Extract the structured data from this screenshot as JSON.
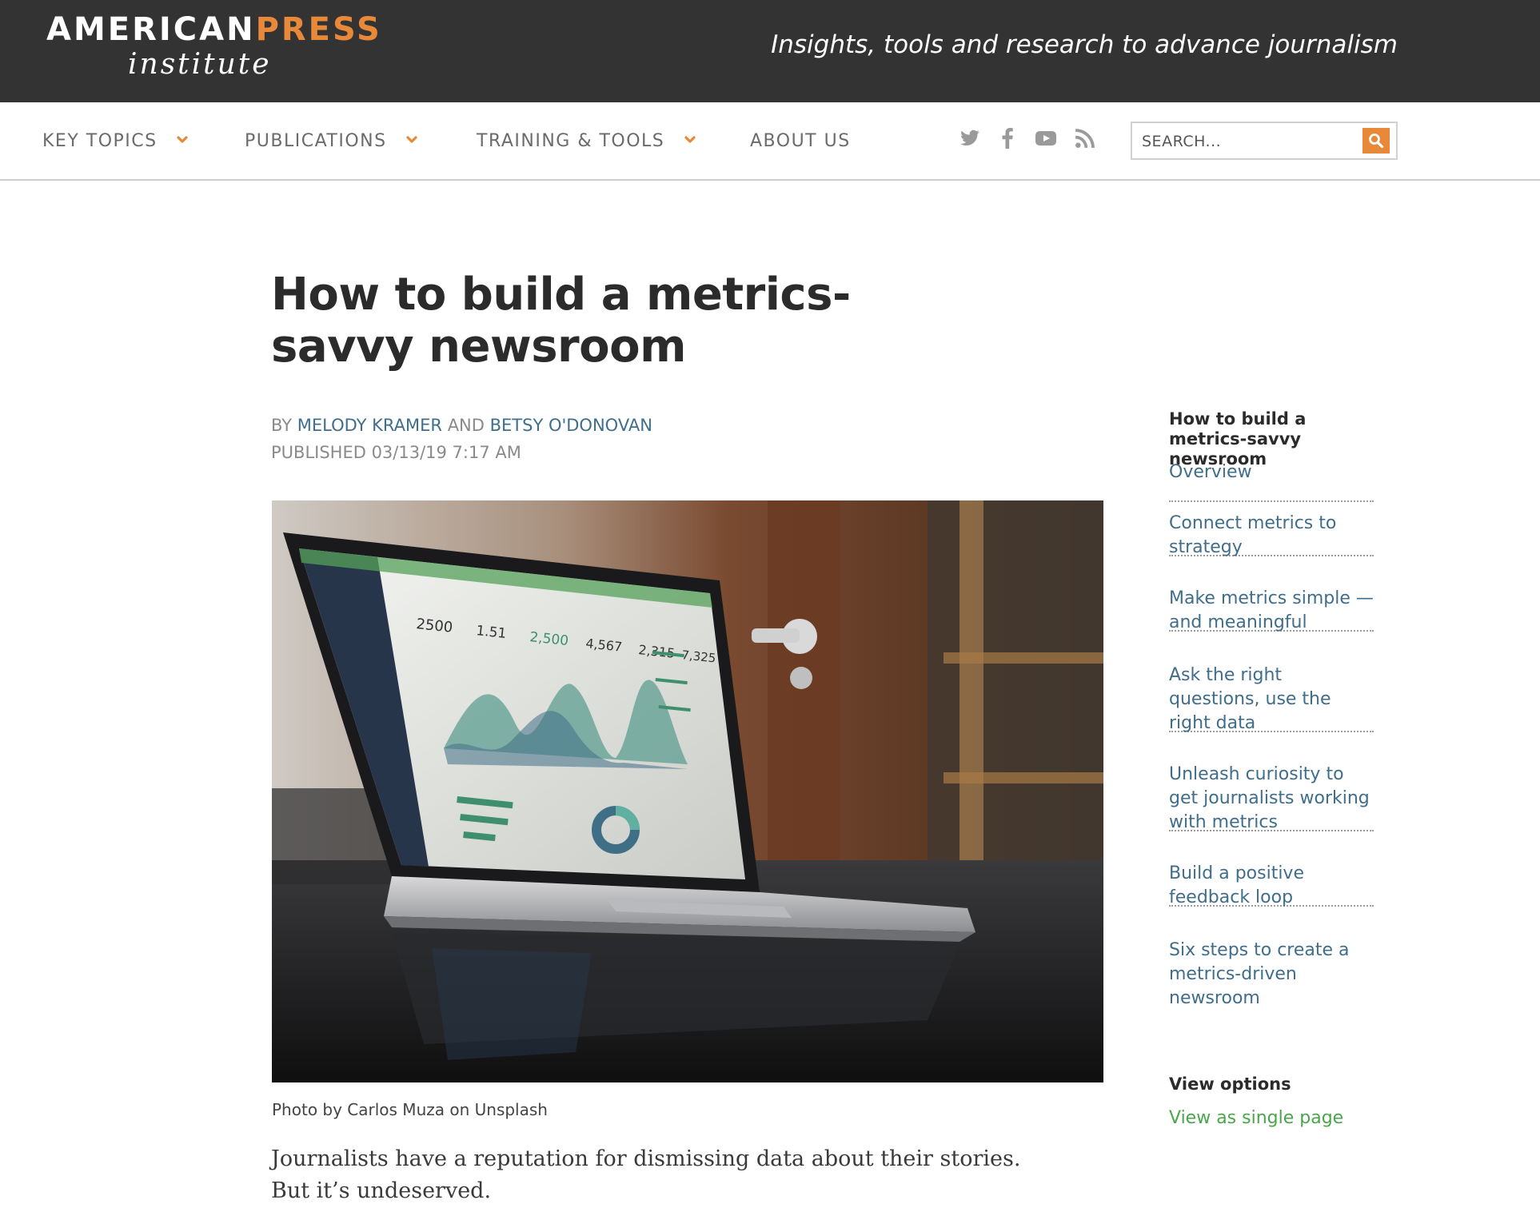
{
  "header": {
    "logo_line1_a": "AMERICAN",
    "logo_line1_b": "PRESS",
    "logo_line2": "institute",
    "tagline": "Insights, tools and research to advance journalism"
  },
  "nav": {
    "items": [
      {
        "label": "KEY TOPICS",
        "has_dropdown": true
      },
      {
        "label": "PUBLICATIONS",
        "has_dropdown": true
      },
      {
        "label": "TRAINING & TOOLS",
        "has_dropdown": true
      },
      {
        "label": "ABOUT US",
        "has_dropdown": false
      }
    ],
    "social_icons": [
      "twitter-icon",
      "facebook-icon",
      "youtube-icon",
      "rss-icon"
    ],
    "search": {
      "placeholder": "SEARCH...",
      "value": ""
    }
  },
  "article": {
    "title": "How to build a metrics-savvy newsroom",
    "by_prefix": "BY ",
    "author1": "MELODY KRAMER",
    "and": " AND ",
    "author2": "BETSY O'DONOVAN",
    "published": "PUBLISHED 03/13/19 7:17 AM",
    "photo_caption": "Photo by Carlos Muza on Unsplash",
    "lede": "Journalists have a reputation for dismissing data about their stories. But it’s undeserved."
  },
  "sidebar": {
    "toc_title": "How to build a metrics-savvy newsroom",
    "items": [
      "Overview",
      "Connect metrics to strategy",
      "Make metrics simple — and meaningful",
      "Ask the right questions, use the right data",
      "Unleash curiosity to get journalists working with metrics",
      "Build a positive feedback loop",
      "Six steps to create a metrics-driven newsroom"
    ],
    "view_options_title": "View options",
    "view_single_page": "View as single page"
  },
  "colors": {
    "banner_bg": "#333333",
    "accent_orange": "#e8893a",
    "link_blue": "#3f6e8c",
    "link_green": "#4aa64a"
  }
}
